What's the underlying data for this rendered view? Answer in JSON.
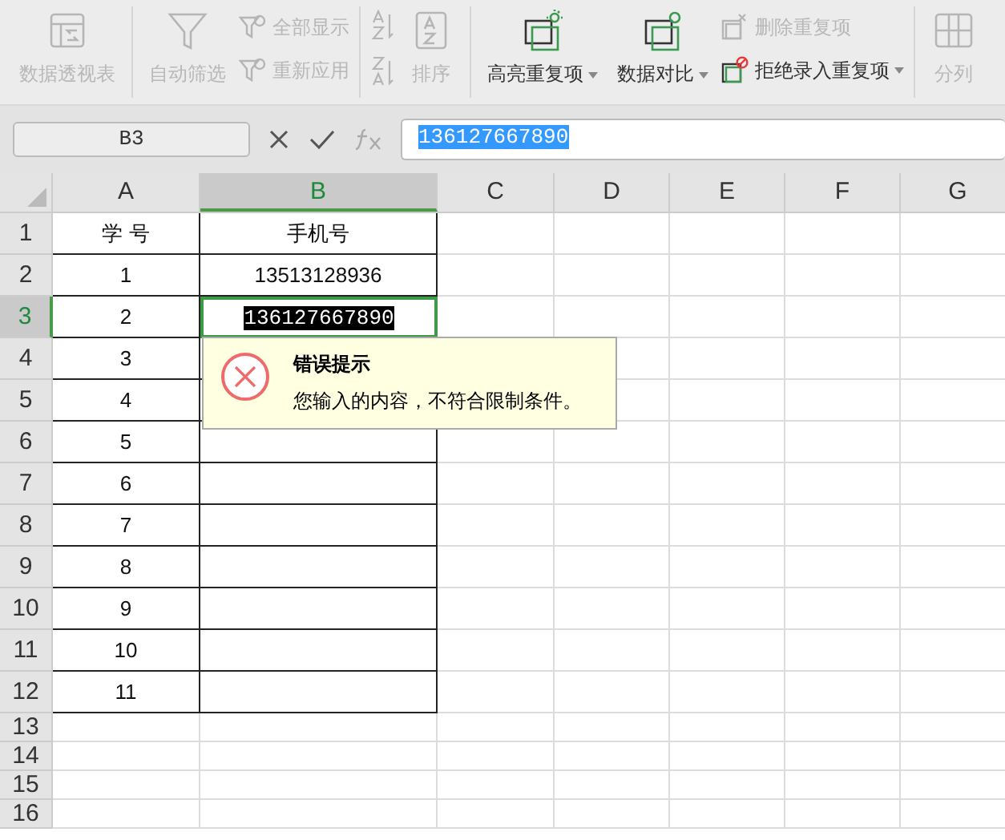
{
  "ribbon": {
    "groups": [
      {
        "items": [
          {
            "kind": "large",
            "label": "数据透视表",
            "disabled": true,
            "dropdown": false
          }
        ]
      },
      {
        "items": [
          {
            "kind": "large",
            "label": "自动筛选",
            "disabled": true,
            "dropdown": false
          },
          {
            "kind": "small",
            "label": "全部显示",
            "disabled": true,
            "dropdown": false
          },
          {
            "kind": "small",
            "label": "重新应用",
            "disabled": true,
            "dropdown": false
          }
        ]
      },
      {
        "items": [
          {
            "kind": "icon",
            "disabled": true
          },
          {
            "kind": "icon",
            "disabled": true
          },
          {
            "kind": "large",
            "label": "排序",
            "disabled": true,
            "dropdown": false
          }
        ]
      },
      {
        "items": [
          {
            "kind": "large",
            "label": "高亮重复项",
            "disabled": false,
            "dropdown": true
          },
          {
            "kind": "large",
            "label": "数据对比",
            "disabled": false,
            "dropdown": true
          },
          {
            "kind": "small",
            "label": "删除重复项",
            "disabled": true,
            "dropdown": false
          },
          {
            "kind": "small",
            "label": "拒绝录入重复项",
            "disabled": false,
            "dropdown": true
          }
        ]
      },
      {
        "items": [
          {
            "kind": "large",
            "label": "分列",
            "disabled": true,
            "dropdown": false
          }
        ]
      }
    ]
  },
  "name_box": "B3",
  "formula_bar": {
    "value": "136127667890",
    "selected": true
  },
  "columns": [
    {
      "label": "A",
      "selected": false
    },
    {
      "label": "B",
      "selected": true
    },
    {
      "label": "C",
      "selected": false
    },
    {
      "label": "D",
      "selected": false
    },
    {
      "label": "E",
      "selected": false
    },
    {
      "label": "F",
      "selected": false
    },
    {
      "label": "G",
      "selected": false
    }
  ],
  "rows": [
    {
      "label": "1",
      "selected": false,
      "bordered": true,
      "cells": [
        {
          "text": "学  号",
          "selected": false
        },
        {
          "text": "手机号",
          "selected": false
        }
      ]
    },
    {
      "label": "2",
      "selected": false,
      "bordered": true,
      "cells": [
        {
          "text": "1",
          "selected": false
        },
        {
          "text": "13513128936",
          "selected": false
        }
      ]
    },
    {
      "label": "3",
      "selected": true,
      "bordered": true,
      "cells": [
        {
          "text": "2",
          "selected": false
        },
        {
          "text": "136127667890",
          "selected": true
        }
      ]
    },
    {
      "label": "4",
      "selected": false,
      "bordered": true,
      "cells": [
        {
          "text": "3",
          "selected": false
        },
        {
          "selected": false
        }
      ]
    },
    {
      "label": "5",
      "selected": false,
      "bordered": true,
      "cells": [
        {
          "text": "4",
          "selected": false
        },
        {
          "selected": false
        }
      ]
    },
    {
      "label": "6",
      "selected": false,
      "bordered": true,
      "cells": [
        {
          "text": "5",
          "selected": false
        },
        {
          "selected": false
        }
      ]
    },
    {
      "label": "7",
      "selected": false,
      "bordered": true,
      "cells": [
        {
          "text": "6",
          "selected": false
        },
        {
          "selected": false
        }
      ]
    },
    {
      "label": "8",
      "selected": false,
      "bordered": true,
      "cells": [
        {
          "text": "7",
          "selected": false
        },
        {
          "selected": false
        }
      ]
    },
    {
      "label": "9",
      "selected": false,
      "bordered": true,
      "cells": [
        {
          "text": "8",
          "selected": false
        },
        {
          "selected": false
        }
      ]
    },
    {
      "label": "10",
      "selected": false,
      "bordered": true,
      "cells": [
        {
          "text": "9",
          "selected": false
        },
        {
          "selected": false
        }
      ]
    },
    {
      "label": "11",
      "selected": false,
      "bordered": true,
      "cells": [
        {
          "text": "10",
          "selected": false
        },
        {
          "selected": false
        }
      ]
    },
    {
      "label": "12",
      "selected": false,
      "bordered": true,
      "cells": [
        {
          "text": "11",
          "selected": false
        },
        {
          "selected": false
        }
      ]
    },
    {
      "label": "13",
      "selected": false,
      "bordered": false,
      "cells": []
    },
    {
      "label": "14",
      "selected": false,
      "bordered": false,
      "cells": []
    },
    {
      "label": "15",
      "selected": false,
      "bordered": false,
      "cells": []
    },
    {
      "label": "16",
      "selected": false,
      "bordered": false,
      "cells": []
    }
  ],
  "error_tooltip": {
    "title": "错误提示",
    "message": "您输入的内容，不符合限制条件。"
  }
}
